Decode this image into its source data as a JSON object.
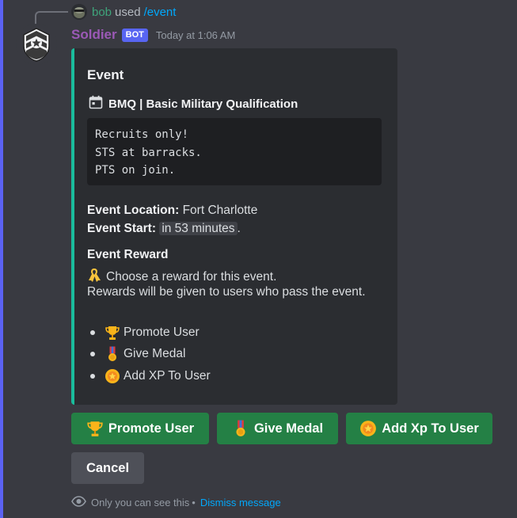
{
  "reply": {
    "username": "bob",
    "used_text": "used",
    "command": "/event"
  },
  "message": {
    "username": "Soldier",
    "bot_tag": "BOT",
    "timestamp": "Today at 1:06 AM"
  },
  "embed": {
    "accent_color": "#1abc9c",
    "title": "Event",
    "event_name": "BMQ | Basic Military Qualification",
    "code_lines": [
      "Recruits only!",
      "STS at barracks.",
      "PTS on join."
    ],
    "location_label": "Event Location:",
    "location_value": "Fort Charlotte",
    "start_label": "Event Start:",
    "start_value": "in 53 minutes",
    "start_suffix": ".",
    "reward_title": "Event Reward",
    "reward_prompt": "Choose a reward for this event.",
    "reward_note": "Rewards will be given to users who pass the event.",
    "reward_options": [
      {
        "icon": "trophy-icon",
        "label": "Promote User"
      },
      {
        "icon": "medal-icon",
        "label": "Give Medal"
      },
      {
        "icon": "star-badge-icon",
        "label": "Add XP To User"
      }
    ]
  },
  "buttons": {
    "promote": "Promote User",
    "medal": "Give Medal",
    "xp": "Add Xp To User",
    "cancel": "Cancel"
  },
  "footer": {
    "ephemeral_text": "Only you can see this",
    "separator": "•",
    "dismiss": "Dismiss message"
  },
  "colors": {
    "background": "#393a41",
    "embed_bg": "#2b2d31",
    "success_button": "#248045",
    "secondary_button": "#4e5058",
    "blurple": "#5865f2",
    "link": "#00a8fc",
    "bot_name": "#9b59b6"
  }
}
